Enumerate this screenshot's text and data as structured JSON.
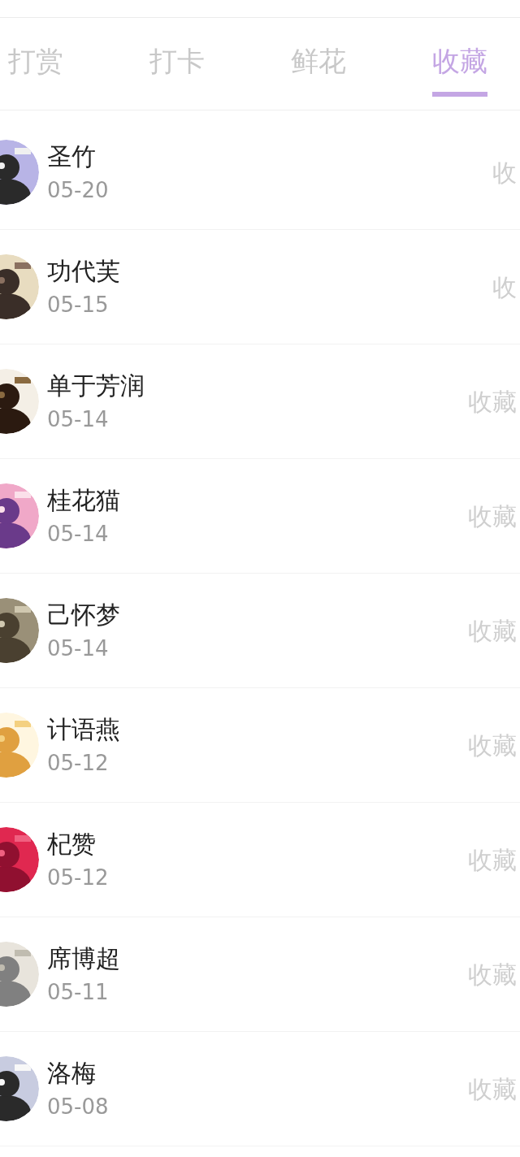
{
  "tabs": [
    {
      "label": "打赏",
      "selected": false
    },
    {
      "label": "打卡",
      "selected": false
    },
    {
      "label": "鲜花",
      "selected": false
    },
    {
      "label": "收藏",
      "selected": true
    }
  ],
  "rows": [
    {
      "name": "圣竹",
      "date": "05-20",
      "action": "收"
    },
    {
      "name": "功代芙",
      "date": "05-15",
      "action": "收"
    },
    {
      "name": "单于芳润",
      "date": "05-14",
      "action": "收藏"
    },
    {
      "name": "桂花猫",
      "date": "05-14",
      "action": "收藏"
    },
    {
      "name": "己怀梦",
      "date": "05-14",
      "action": "收藏"
    },
    {
      "name": "计语燕",
      "date": "05-12",
      "action": "收藏"
    },
    {
      "name": "杞赞",
      "date": "05-12",
      "action": "收藏"
    },
    {
      "name": "席博超",
      "date": "05-11",
      "action": "收藏"
    },
    {
      "name": "洛梅",
      "date": "05-08",
      "action": "收藏"
    }
  ]
}
